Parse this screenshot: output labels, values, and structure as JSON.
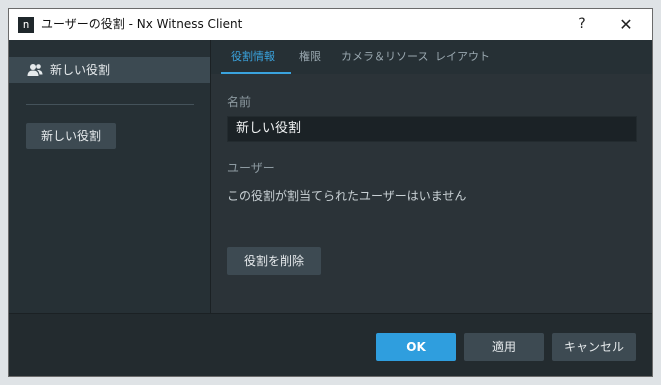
{
  "window": {
    "app_icon_text": "n",
    "title": "ユーザーの役割 - Nx Witness Client",
    "help_label": "?",
    "close_label": "✕"
  },
  "sidebar": {
    "items": [
      {
        "label": "新しい役割",
        "icon": "users-icon"
      }
    ],
    "new_role_button": "新しい役割"
  },
  "tabs": [
    {
      "label": "役割情報",
      "active": true
    },
    {
      "label": "権限",
      "active": false
    },
    {
      "label": "カメラ＆リソース",
      "active": false
    },
    {
      "label": "レイアウト",
      "active": false
    }
  ],
  "main": {
    "name_label": "名前",
    "name_value": "新しい役割",
    "users_label": "ユーザー",
    "no_users_text": "この役割が割当てられたユーザーはいません",
    "delete_button": "役割を削除"
  },
  "footer": {
    "ok": "OK",
    "apply": "適用",
    "cancel": "キャンセル"
  },
  "colors": {
    "accent": "#3aa3de",
    "background": "#2b3338",
    "sidebar": "#263035"
  }
}
